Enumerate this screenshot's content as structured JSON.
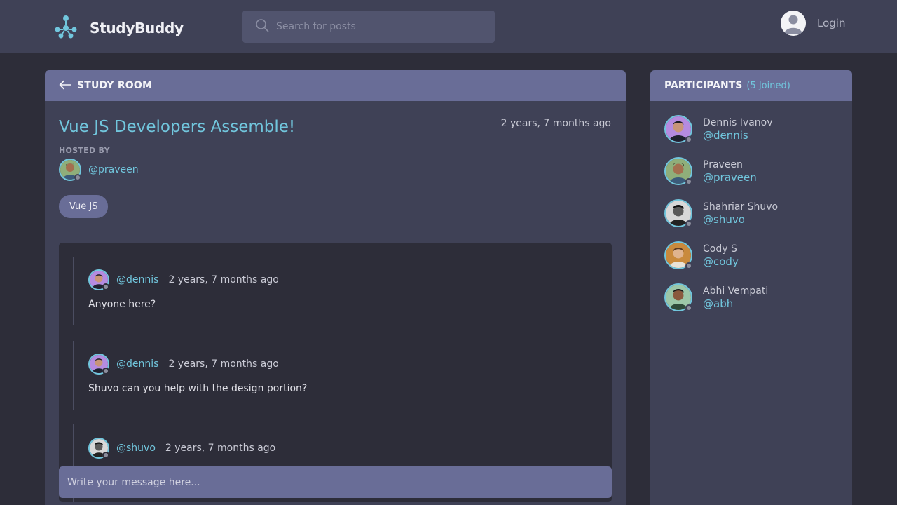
{
  "app": {
    "name": "StudyBuddy"
  },
  "search": {
    "placeholder": "Search for posts"
  },
  "auth": {
    "login_label": "Login"
  },
  "room": {
    "header_label": "STUDY ROOM",
    "title": "Vue JS Developers Assemble!",
    "created": "2 years, 7 months ago",
    "hosted_by_label": "HOSTED BY",
    "host": "@praveen",
    "topic": "Vue JS"
  },
  "messages": [
    {
      "user": "@dennis",
      "time": "2 years, 7 months ago",
      "body": "Anyone here?"
    },
    {
      "user": "@dennis",
      "time": "2 years, 7 months ago",
      "body": "Shuvo can you help with the design portion?"
    },
    {
      "user": "@shuvo",
      "time": "2 years, 7 months ago",
      "body": ""
    }
  ],
  "composer": {
    "placeholder": "Write your message here..."
  },
  "participants": {
    "title": "PARTICIPANTS",
    "count_label": "(5 Joined)",
    "items": [
      {
        "name": "Dennis Ivanov",
        "handle": "@dennis"
      },
      {
        "name": "Praveen",
        "handle": "@praveen"
      },
      {
        "name": "Shahriar Shuvo",
        "handle": "@shuvo"
      },
      {
        "name": "Cody S",
        "handle": "@cody"
      },
      {
        "name": "Abhi Vempati",
        "handle": "@abh"
      }
    ]
  },
  "colors": {
    "background": "#2d2d39",
    "panel": "#3f4156",
    "panel_header": "#696d97",
    "accent": "#71c6dd",
    "input": "#51546e"
  },
  "icons": [
    "logo-icon",
    "search-icon",
    "user-silhouette-icon",
    "back-arrow-icon",
    "status-dot-icon"
  ]
}
